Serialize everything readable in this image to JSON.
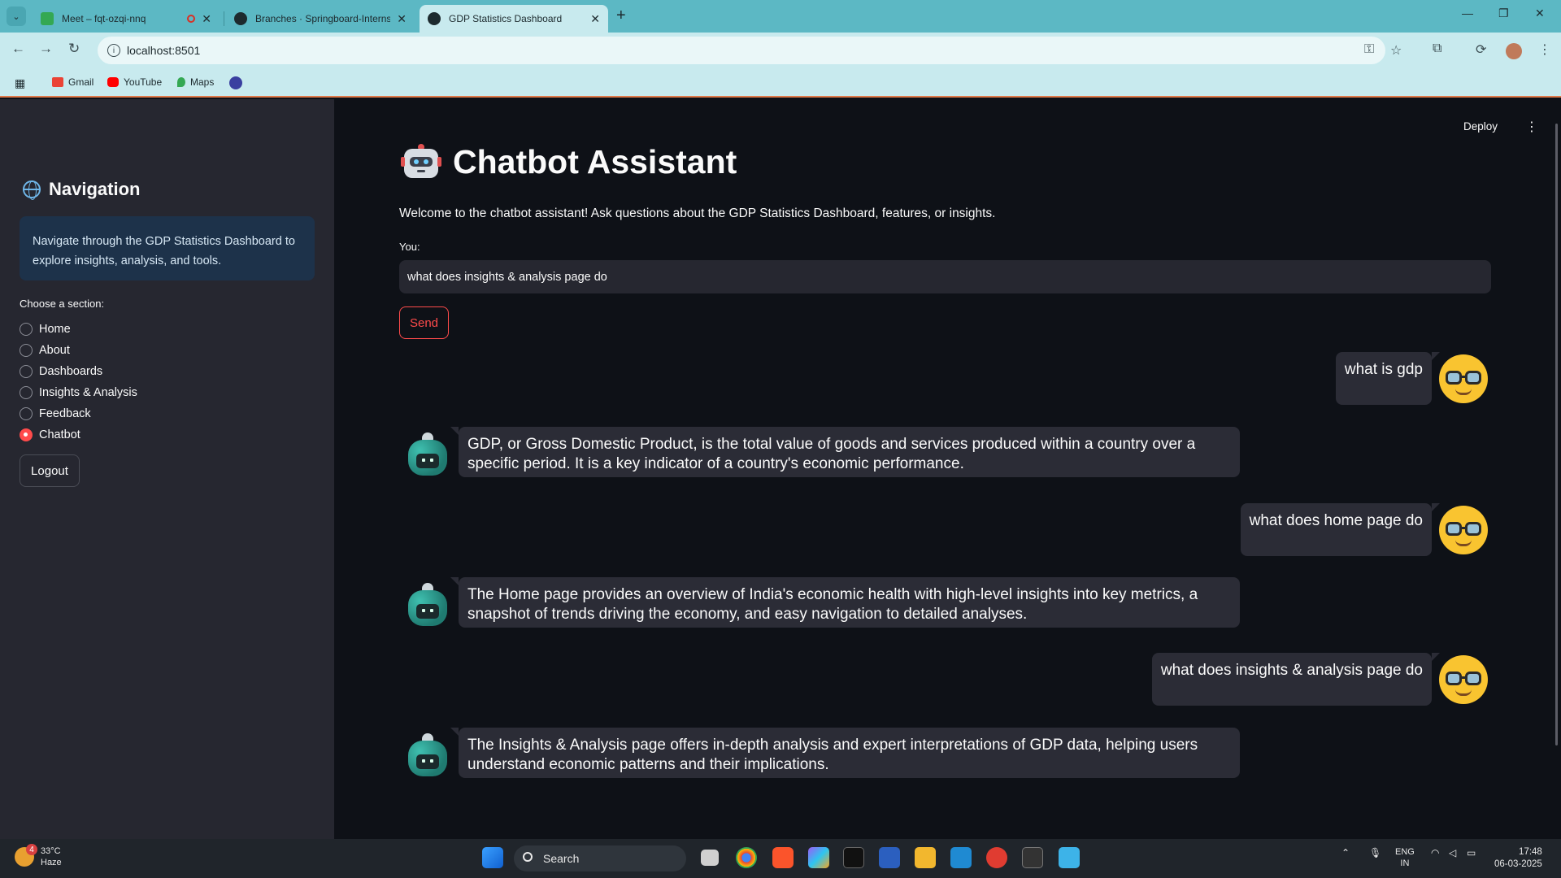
{
  "browser": {
    "tabs": [
      {
        "title": "Meet – fqt-ozqi-nnq",
        "color": "#34a853"
      },
      {
        "title": "Branches · Springboard-Internshi",
        "color": "#1d2a2e"
      },
      {
        "title": "GDP Statistics Dashboard",
        "color": "#1d2a2e"
      }
    ],
    "url": "localhost:8501",
    "bookmarks": [
      "Gmail",
      "YouTube",
      "Maps"
    ]
  },
  "sidebar": {
    "title": "Navigation",
    "info": "Navigate through the GDP Statistics Dashboard to explore insights, analysis, and tools.",
    "choose_label": "Choose a section:",
    "sections": [
      "Home",
      "About",
      "Dashboards",
      "Insights & Analysis",
      "Feedback",
      "Chatbot"
    ],
    "selected_section": "Chatbot",
    "logout_label": "Logout"
  },
  "header": {
    "deploy_label": "Deploy"
  },
  "main": {
    "title": "Chatbot Assistant",
    "welcome": "Welcome to the chatbot assistant! Ask questions about the GDP Statistics Dashboard, features, or insights.",
    "you_label": "You:",
    "input_value": "what does insights & analysis page do",
    "send_label": "Send",
    "messages": [
      {
        "role": "user",
        "text": "what is gdp"
      },
      {
        "role": "bot",
        "text": "GDP, or Gross Domestic Product, is the total value of goods and services produced within a country over a specific period. It is a key indicator of a country's economic performance."
      },
      {
        "role": "user",
        "text": "what does home page do"
      },
      {
        "role": "bot",
        "text": "The Home page provides an overview of India's economic health with high-level insights into key metrics, a snapshot of trends driving the economy, and easy navigation to detailed analyses."
      },
      {
        "role": "user",
        "text": "what does insights & analysis page do"
      },
      {
        "role": "bot",
        "text": "The Insights & Analysis page offers in-depth analysis and expert interpretations of GDP data, helping users understand economic patterns and their implications."
      }
    ]
  },
  "taskbar": {
    "weather_badge": "4",
    "temperature": "33°C",
    "condition": "Haze",
    "search_label": "Search",
    "lang_line1": "ENG",
    "lang_line2": "IN",
    "time": "17:48",
    "date": "06-03-2025"
  }
}
